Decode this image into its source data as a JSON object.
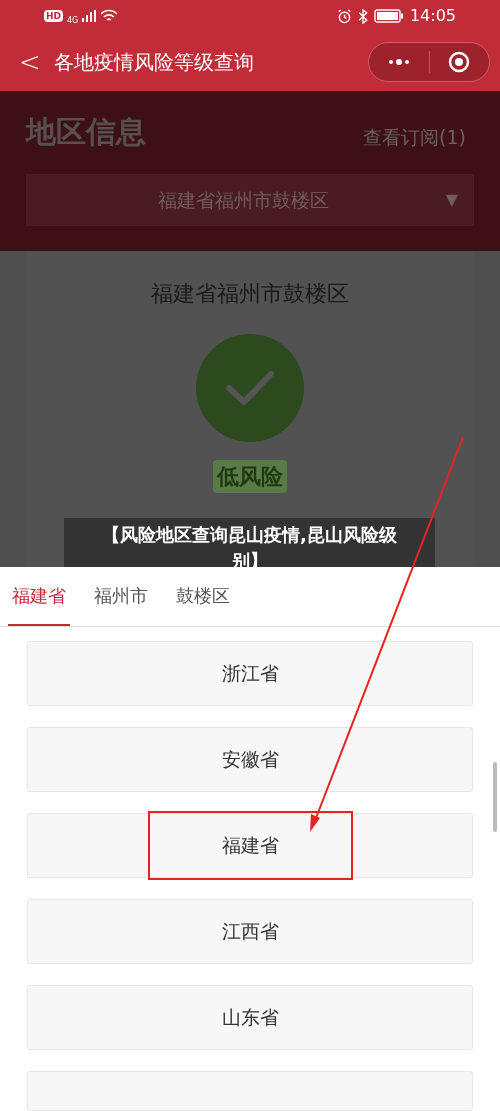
{
  "status_bar": {
    "hd": "HD",
    "network": "4G",
    "time": "14:05"
  },
  "nav": {
    "back": "<",
    "title": "各地疫情风险等级查询"
  },
  "region": {
    "heading": "地区信息",
    "subscribe_link": "查看订阅(1)",
    "dropdown": {
      "value": "福建省福州市鼓楼区",
      "caret": "▼"
    },
    "card": {
      "title": "福建省福州市鼓楼区",
      "risk": "低风险"
    }
  },
  "caption": "【风险地区查询昆山疫情,昆山风险级别】",
  "picker": {
    "tabs": [
      {
        "label": "福建省",
        "selected": true
      },
      {
        "label": "福州市",
        "selected": false
      },
      {
        "label": "鼓楼区",
        "selected": false
      }
    ],
    "options": [
      {
        "label": "浙江省",
        "highlighted": false
      },
      {
        "label": "安徽省",
        "highlighted": false
      },
      {
        "label": "福建省",
        "highlighted": true
      },
      {
        "label": "江西省",
        "highlighted": false
      },
      {
        "label": "山东省",
        "highlighted": false
      }
    ]
  }
}
